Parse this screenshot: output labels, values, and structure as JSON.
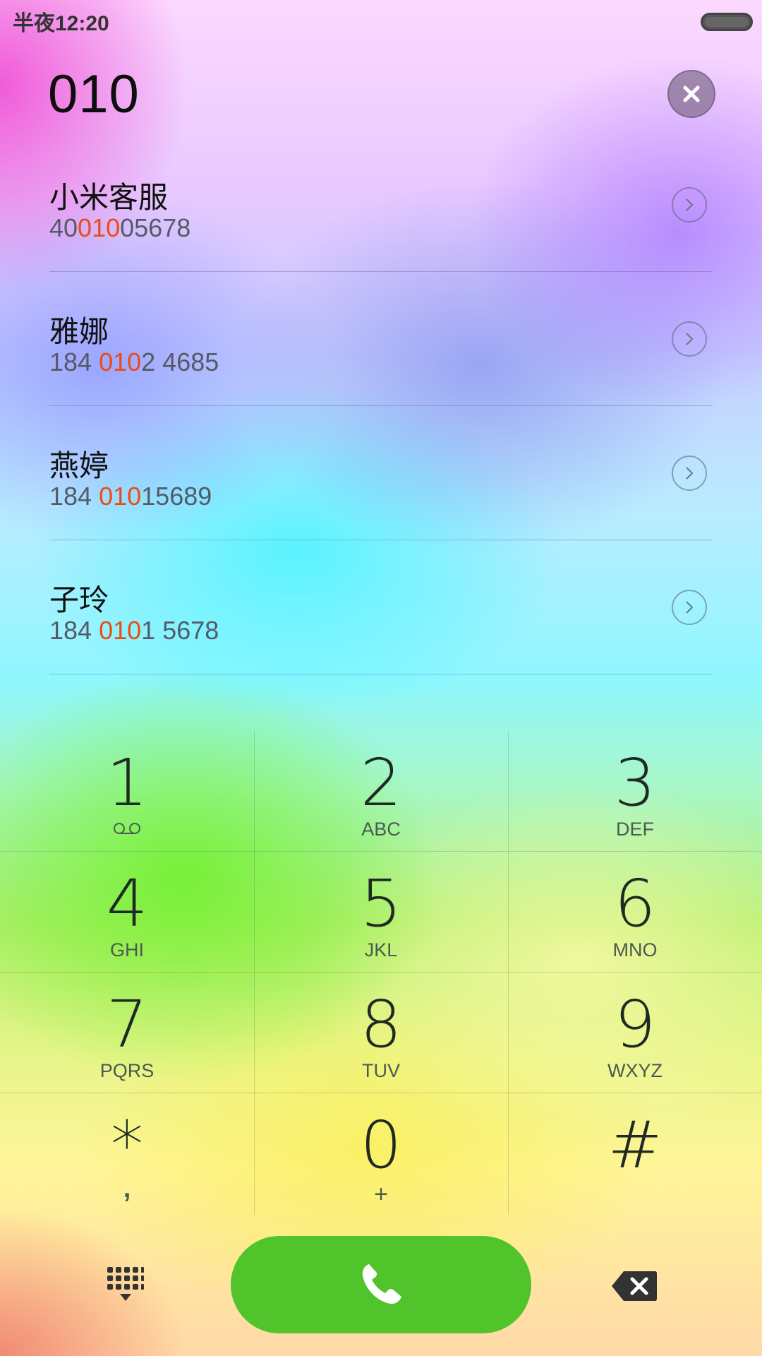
{
  "status_bar": {
    "time": "半夜12:20"
  },
  "dialer": {
    "dialed_number": "010",
    "contacts": [
      {
        "name": "小米客服",
        "number_pre": "40",
        "number_match": "010",
        "number_post": "05678"
      },
      {
        "name": "雅娜",
        "number_pre": "184 ",
        "number_match": "010",
        "number_post": "2 4685"
      },
      {
        "name": "燕婷",
        "number_pre": "184 ",
        "number_match": "010",
        "number_post": "15689"
      },
      {
        "name": "子玲",
        "number_pre": "184 ",
        "number_match": "010",
        "number_post": "1 5678"
      }
    ],
    "keys": [
      {
        "digit": "1",
        "letters": ""
      },
      {
        "digit": "2",
        "letters": "ABC"
      },
      {
        "digit": "3",
        "letters": "DEF"
      },
      {
        "digit": "4",
        "letters": "GHI"
      },
      {
        "digit": "5",
        "letters": "JKL"
      },
      {
        "digit": "6",
        "letters": "MNO"
      },
      {
        "digit": "7",
        "letters": "PQRS"
      },
      {
        "digit": "8",
        "letters": "TUV"
      },
      {
        "digit": "9",
        "letters": "WXYZ"
      },
      {
        "digit": "*",
        "letters": ","
      },
      {
        "digit": "0",
        "letters": "+"
      },
      {
        "digit": "#",
        "letters": ""
      }
    ]
  },
  "colors": {
    "call_green": "#50c42a",
    "match_highlight": "#ef4a14"
  },
  "icons": {
    "clear": "close-icon",
    "contact_arrow": "chevron-right-icon",
    "voicemail": "voicemail-icon",
    "keypad_toggle": "keypad-icon",
    "call": "phone-icon",
    "backspace": "backspace-icon"
  }
}
